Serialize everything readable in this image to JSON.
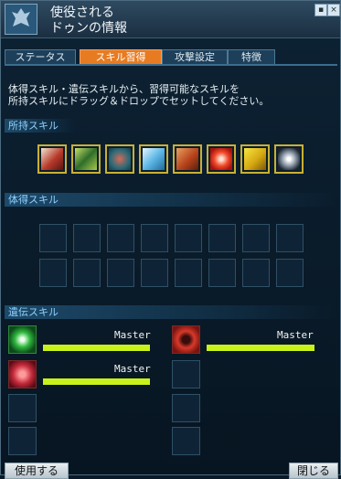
{
  "window": {
    "title_line1": "使役される",
    "title_line2": "ドゥンの情報",
    "minimize_glyph": "▪",
    "close_glyph": "×"
  },
  "tabs": [
    {
      "label": "ステータス"
    },
    {
      "label": "スキル習得"
    },
    {
      "label": "攻撃設定"
    },
    {
      "label": "特徴"
    }
  ],
  "active_tab": "スキル習得",
  "description": {
    "line1": "体得スキル・遺伝スキルから、習得可能なスキルを",
    "line2": "所持スキルにドラッグ＆ドロップでセットしてください。"
  },
  "sections": {
    "owned": "所持スキル",
    "learned": "体得スキル",
    "inherited": "遺伝スキル"
  },
  "owned_skills": [
    {
      "icon": "crimson-figure-skill-icon"
    },
    {
      "icon": "claw-slash-skill-icon"
    },
    {
      "icon": "rune-circle-skill-icon"
    },
    {
      "icon": "ice-shard-skill-icon"
    },
    {
      "icon": "flame-warrior-skill-icon"
    },
    {
      "icon": "fire-orb-skill-icon"
    },
    {
      "icon": "golden-silhouette-skill-icon"
    },
    {
      "icon": "spiral-skill-icon"
    }
  ],
  "inherited_skills": [
    {
      "icon": "green-ring-skill-icon",
      "level": "Master",
      "progress": 1.0
    },
    {
      "icon": "red-cross-seal-skill-icon",
      "level": "Master",
      "progress": 1.0
    },
    {
      "icon": "red-mesh-skill-icon",
      "level": "Master",
      "progress": 1.0
    }
  ],
  "buttons": {
    "use": "使用する",
    "close": "閉じる"
  }
}
